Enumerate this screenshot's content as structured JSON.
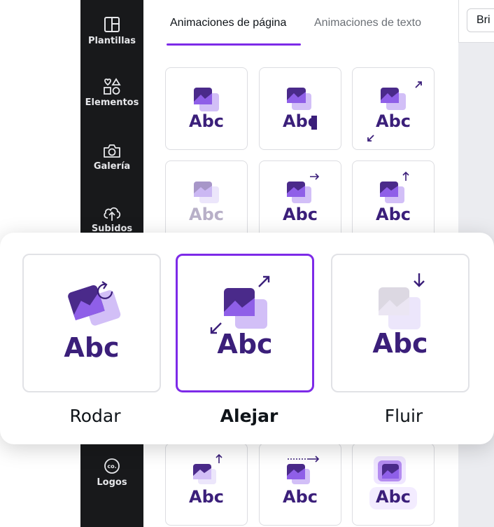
{
  "sidebar": {
    "items": [
      {
        "label": "Plantillas",
        "icon": "templates-icon"
      },
      {
        "label": "Elementos",
        "icon": "elements-icon"
      },
      {
        "label": "Galería",
        "icon": "camera-icon"
      },
      {
        "label": "Subidos",
        "icon": "upload-icon"
      },
      {
        "label": "Logos",
        "icon": "logo-icon"
      }
    ]
  },
  "panel": {
    "tabs": [
      {
        "label": "Animaciones de página",
        "active": true
      },
      {
        "label": "Animaciones de texto",
        "active": false
      }
    ],
    "card_text": "Abc"
  },
  "toolbar": {
    "brightness_label": "Bri"
  },
  "popup": {
    "options": [
      {
        "label": "Rodar",
        "text": "Abc",
        "selected": false
      },
      {
        "label": "Alejar",
        "text": "Abc",
        "selected": true
      },
      {
        "label": "Fluir",
        "text": "Abc",
        "selected": false
      }
    ]
  },
  "colors": {
    "accent": "#7d2ae8",
    "sidebar_bg": "#18191b",
    "brand_text": "#3b1f7a",
    "tile_dark": "#4a2a8a",
    "tile_light": "#c9b3f5"
  }
}
